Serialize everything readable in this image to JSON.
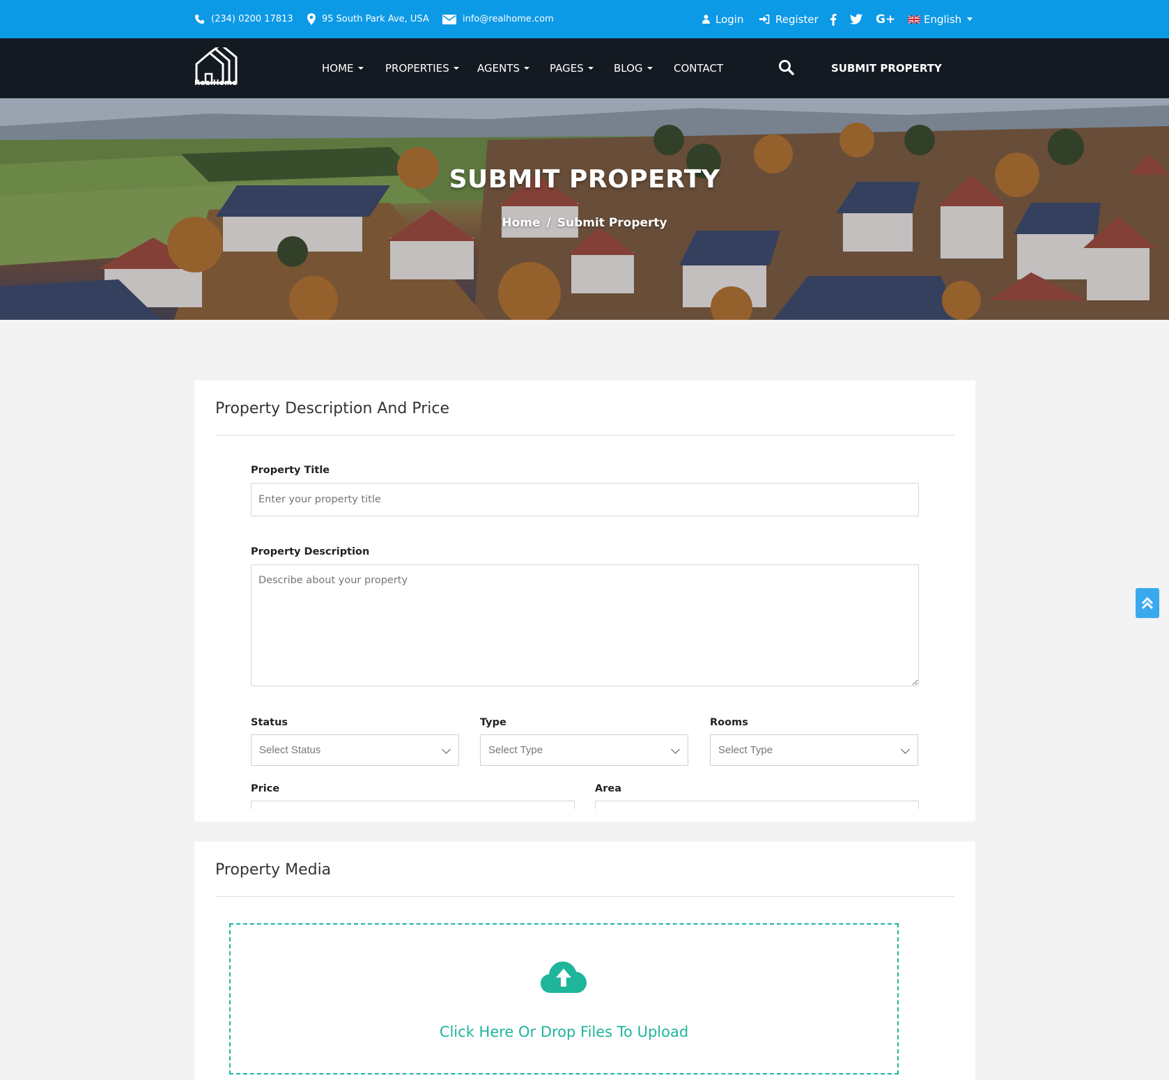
{
  "topbar": {
    "phone": "(234) 0200 17813",
    "address": "95 South Park Ave, USA",
    "email": "info@realhome.com",
    "login": "Login",
    "register": "Register",
    "language": "English"
  },
  "brand": {
    "name": "RealHome"
  },
  "nav": {
    "items": [
      "HOME",
      "PROPERTIES",
      "AGENTS",
      "PAGES",
      "BLOG",
      "CONTACT"
    ],
    "submit": "SUBMIT PROPERTY"
  },
  "hero": {
    "title": "SUBMIT PROPERTY",
    "breadcrumb_home": "Home",
    "breadcrumb_sep": "/",
    "breadcrumb_current": "Submit Property"
  },
  "description_section": {
    "title": "Property Description And Price",
    "title_label": "Property Title",
    "title_placeholder": "Enter your property title",
    "desc_label": "Property Description",
    "desc_placeholder": "Describe about your property",
    "status_label": "Status",
    "status_value": "Select Status",
    "type_label": "Type",
    "type_value": "Select Type",
    "rooms_label": "Rooms",
    "rooms_value": "Select Type",
    "price_label": "Price",
    "area_label": "Area"
  },
  "media_section": {
    "title": "Property Media",
    "upload_text": "Click Here Or Drop Files To Upload"
  },
  "colors": {
    "topbar": "#0c99e6",
    "navbar": "#141a21",
    "accent_green": "#1eb59a",
    "scroll_top": "#3ba9ee"
  }
}
